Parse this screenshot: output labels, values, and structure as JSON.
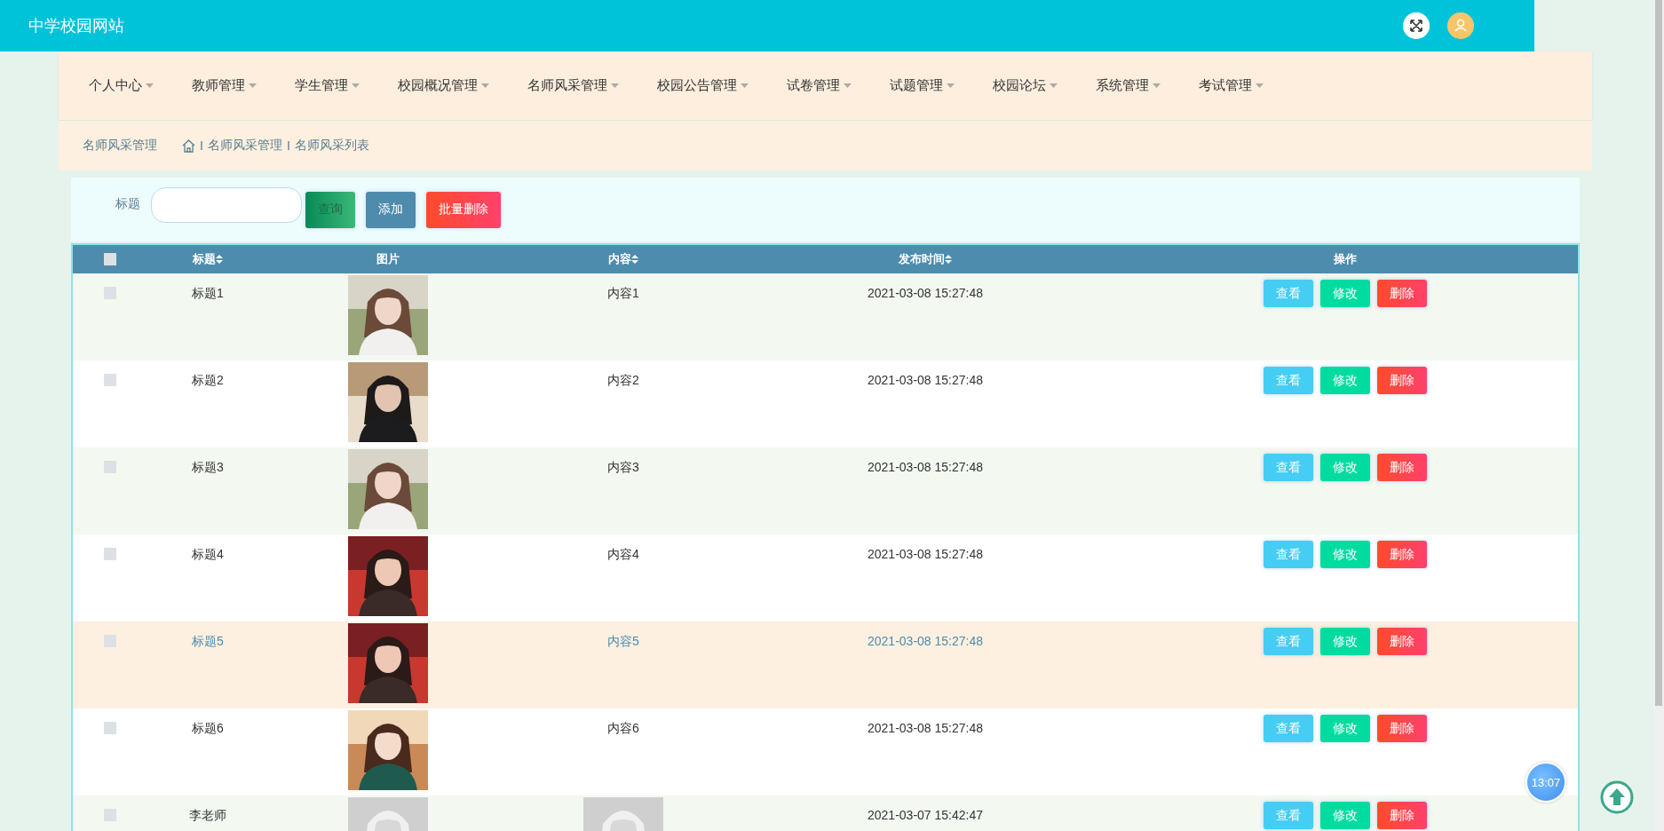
{
  "header": {
    "title": "中学校园网站"
  },
  "nav": [
    {
      "label": "个人中心"
    },
    {
      "label": "教师管理"
    },
    {
      "label": "学生管理"
    },
    {
      "label": "校园概况管理"
    },
    {
      "label": "名师风采管理"
    },
    {
      "label": "校园公告管理"
    },
    {
      "label": "试卷管理"
    },
    {
      "label": "试题管理"
    },
    {
      "label": "校园论坛"
    },
    {
      "label": "系统管理"
    },
    {
      "label": "考试管理"
    }
  ],
  "breadcrumb": {
    "title": "名师风采管理",
    "items": [
      {
        "separator": "I",
        "label": "名师风采管理"
      },
      {
        "separator": "I",
        "label": "名师风采列表"
      }
    ]
  },
  "search": {
    "label": "标题",
    "buttons": [
      {
        "label": "查询",
        "kind": "search"
      },
      {
        "label": "添加",
        "kind": "add"
      },
      {
        "label": "批量删除",
        "kind": "delete"
      }
    ]
  },
  "table": {
    "all_checked": false,
    "columns": [
      {
        "kind": "checkbox"
      },
      {
        "label": "标题",
        "sortable": true
      },
      {
        "label": "图片",
        "sortable": false
      },
      {
        "label": "内容",
        "sortable": true
      },
      {
        "label": "发布时间",
        "sortable": true
      },
      {
        "label": "操作",
        "sortable": false
      }
    ],
    "rows": [
      {
        "checked": false,
        "hovered": false,
        "title": "标题1",
        "content": {
          "kind": "text",
          "text": "内容1"
        },
        "time": "2021-03-08 15:27:48",
        "actions": [
          {
            "label": "查看",
            "kind": "view"
          },
          {
            "label": "修改",
            "kind": "edit"
          },
          {
            "label": "删除",
            "kind": "delete"
          }
        ]
      },
      {
        "checked": false,
        "hovered": false,
        "title": "标题2",
        "content": {
          "kind": "text",
          "text": "内容2"
        },
        "time": "2021-03-08 15:27:48",
        "actions": [
          {
            "label": "查看",
            "kind": "view"
          },
          {
            "label": "修改",
            "kind": "edit"
          },
          {
            "label": "删除",
            "kind": "delete"
          }
        ]
      },
      {
        "checked": false,
        "hovered": false,
        "title": "标题3",
        "content": {
          "kind": "text",
          "text": "内容3"
        },
        "time": "2021-03-08 15:27:48",
        "actions": [
          {
            "label": "查看",
            "kind": "view"
          },
          {
            "label": "修改",
            "kind": "edit"
          },
          {
            "label": "删除",
            "kind": "delete"
          }
        ]
      },
      {
        "checked": false,
        "hovered": false,
        "title": "标题4",
        "content": {
          "kind": "text",
          "text": "内容4"
        },
        "time": "2021-03-08 15:27:48",
        "actions": [
          {
            "label": "查看",
            "kind": "view"
          },
          {
            "label": "修改",
            "kind": "edit"
          },
          {
            "label": "删除",
            "kind": "delete"
          }
        ]
      },
      {
        "checked": false,
        "hovered": true,
        "title": "标题5",
        "content": {
          "kind": "text",
          "text": "内容5"
        },
        "time": "2021-03-08 15:27:48",
        "actions": [
          {
            "label": "查看",
            "kind": "view"
          },
          {
            "label": "修改",
            "kind": "edit"
          },
          {
            "label": "删除",
            "kind": "delete"
          }
        ]
      },
      {
        "checked": false,
        "hovered": false,
        "title": "标题6",
        "content": {
          "kind": "text",
          "text": "内容6"
        },
        "time": "2021-03-08 15:27:48",
        "actions": [
          {
            "label": "查看",
            "kind": "view"
          },
          {
            "label": "修改",
            "kind": "edit"
          },
          {
            "label": "删除",
            "kind": "delete"
          }
        ]
      },
      {
        "checked": false,
        "hovered": false,
        "title": "李老师",
        "time": "2021-03-07 15:42:47",
        "actions": [
          {
            "label": "查看",
            "kind": "view"
          },
          {
            "label": "修改",
            "kind": "edit"
          },
          {
            "label": "删除",
            "kind": "delete"
          }
        ]
      }
    ]
  },
  "clock": {
    "time": "13:07"
  }
}
